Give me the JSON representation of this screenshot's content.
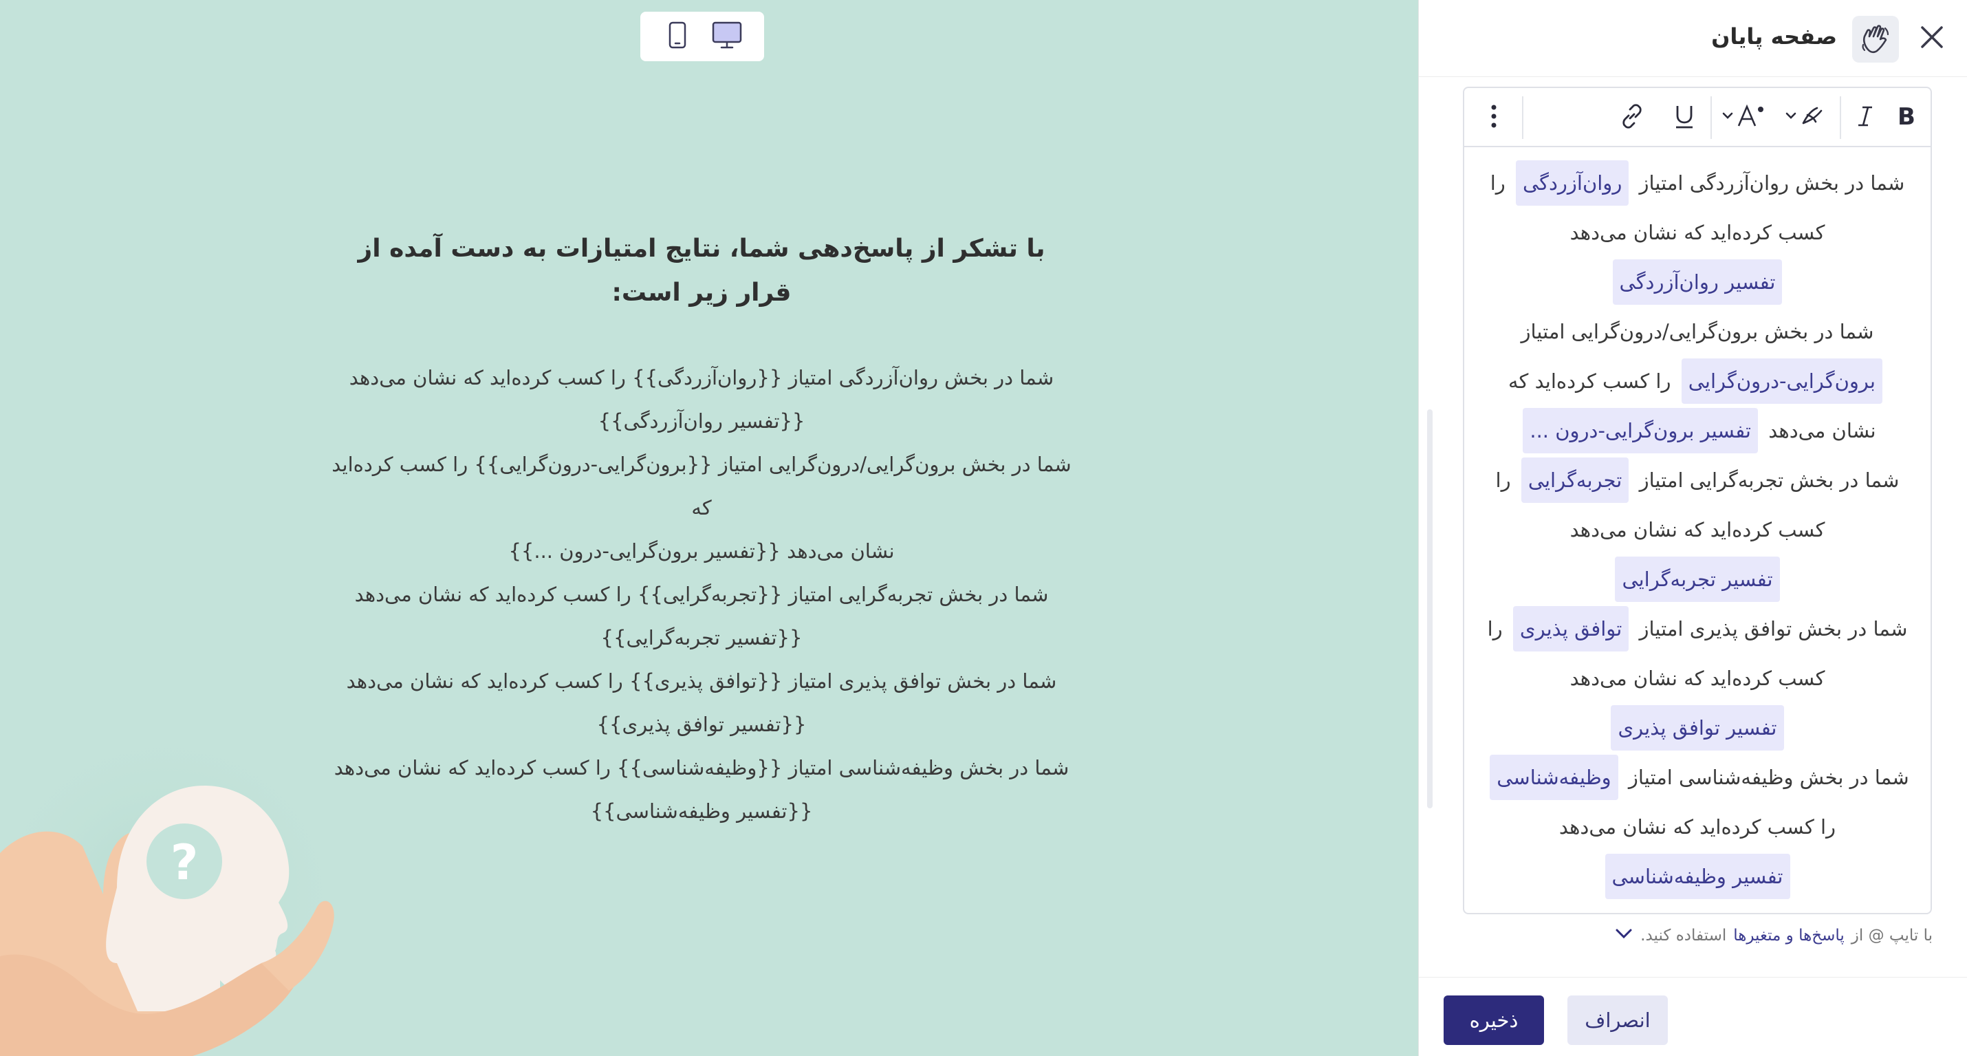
{
  "preview": {
    "heading": "با تشکر از پاسخ‌دهی شما، نتایج امتیازات به دست آمده از قرار زیر است:",
    "lines": [
      "شما در بخش روان‌آزردگی امتیاز {{روان‌آزردگی}} را کسب کرده‌اید که نشان می‌دهد",
      "{{تفسیر روان‌آزردگی}}",
      "شما در بخش برون‌گرایی/درون‌گرایی امتیاز {{برون‌گرایی-درون‌گرایی}} را کسب کرده‌اید که",
      "نشان می‌دهد {{تفسیر برون‌گرایی-درون ...}}",
      "شما در بخش تجربه‌گرایی امتیاز {{تجربه‌گرایی}} را کسب کرده‌اید که نشان می‌دهد",
      "{{تفسیر تجربه‌گرایی}}",
      "شما در بخش توافق پذیری امتیاز {{توافق پذیری}} را کسب کرده‌اید که نشان می‌دهد",
      "{{تفسیر توافق پذیری}}",
      "شما در بخش وظیفه‌شناسی امتیاز {{وظیفه‌شناسی}} را کسب کرده‌اید که نشان می‌دهد",
      "{{تفسیر وظیفه‌شناسی}}"
    ],
    "device_icons": [
      "desktop-icon",
      "mobile-icon"
    ],
    "selected_device": "desktop"
  },
  "panel": {
    "title": "صفحه پایان",
    "header_icon": "waving-hand-icon"
  },
  "toolbar": {
    "buttons": [
      "bold-icon",
      "italic-icon",
      "text-color-icon",
      "font-size-icon",
      "underline-icon",
      "link-icon",
      "more-icon"
    ]
  },
  "editor": {
    "p1": {
      "t1": "شما در بخش روان‌آزردگی امتیاز",
      "v1": "روان‌آزردگی",
      "t2": "را کسب کرده‌اید که نشان می‌دهد",
      "v2": "تفسیر روان‌آزردگی"
    },
    "p2": {
      "t1": "شما در بخش برون‌گرایی/درون‌گرایی امتیاز",
      "v1": "برون‌گرایی-درون‌گرایی",
      "t2": "را کسب کرده‌اید که نشان می‌دهد",
      "v2": "تفسیر برون‌گرایی-درون ..."
    },
    "p3": {
      "t1": "شما در بخش تجربه‌گرایی امتیاز",
      "v1": "تجربه‌گرایی",
      "t2": "را کسب کرده‌اید که نشان می‌دهد",
      "v2": "تفسیر تجربه‌گرایی"
    },
    "p4": {
      "t1": "شما در بخش توافق پذیری امتیاز",
      "v1": "توافق پذیری",
      "t2": "را کسب کرده‌اید که نشان می‌دهد",
      "v2": "تفسیر توافق پذیری"
    },
    "p5": {
      "t1": "شما در بخش وظیفه‌شناسی امتیاز",
      "v1": "وظیفه‌شناسی",
      "t2": "را کسب کرده‌اید که نشان می‌دهد",
      "v2": "تفسیر وظیفه‌شناسی"
    }
  },
  "hint": {
    "prefix": "با تایپ @ از",
    "link": "پاسخ‌ها و متغیرها",
    "suffix": "استفاده کنید."
  },
  "footer": {
    "save_label": "ذخیره",
    "cancel_label": "انصراف"
  },
  "colors": {
    "preview_bg": "#c4e3da",
    "primary": "#2d2b7c",
    "chip_bg": "#e8e8fb"
  }
}
